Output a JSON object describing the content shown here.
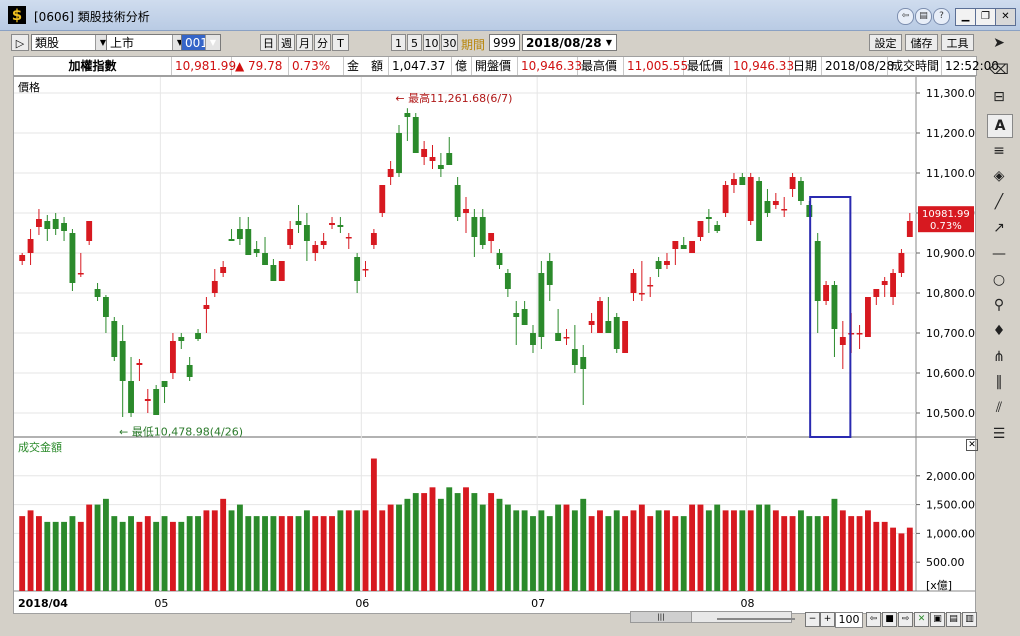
{
  "window": {
    "title": "[0606] 類股技術分析"
  },
  "toolbar": {
    "category": "類股",
    "market": "上市",
    "code": "001",
    "period_buttons": [
      "日",
      "週",
      "月",
      "分",
      "T"
    ],
    "interval_buttons": [
      "1",
      "5",
      "10",
      "30"
    ],
    "period_label": "期間",
    "period_value": "999",
    "date": "2018/08/28",
    "settings": "設定",
    "save": "儲存",
    "tools": "工具"
  },
  "info": {
    "name": "加權指數",
    "price": "10,981.99",
    "change": "▲ 79.78",
    "pct": "0.73%",
    "amount_label": "金　額",
    "amount_value": "1,047.37",
    "amount_unit": "億",
    "open_label": "開盤價",
    "open_value": "10,946.33",
    "high_label": "最高價",
    "high_value": "11,005.55",
    "low_label": "最低價",
    "low_value": "10,946.33",
    "date_label": "日期",
    "date_value": "2018/08/28",
    "time_label": "成交時間",
    "time_value": "12:52:00"
  },
  "chart_data": [
    {
      "type": "candlestick",
      "title": "價格",
      "ylim": [
        10440,
        11340
      ],
      "yticks": [
        10500,
        10600,
        10700,
        10800,
        10900,
        11000,
        11100,
        11200,
        11300
      ],
      "ytick_labels": [
        "10,500.00",
        "10,600.00",
        "10,700.00",
        "10,800.00",
        "10,900.00",
        "11,000.00",
        "11,100.00",
        "11,200.00",
        "11,300.00"
      ],
      "x_labels": [
        "2018/04",
        "05",
        "06",
        "07",
        "08"
      ],
      "x_label_index": [
        0,
        17,
        41,
        62,
        87
      ],
      "annotation_high": "最高11,261.68(6/7)",
      "annotation_low": "最低10,478.98(4/26)",
      "last_price_tag": [
        "10981.99",
        "0.73%"
      ],
      "ohlc": [
        [
          10880,
          10900,
          10870,
          10895
        ],
        [
          10900,
          10960,
          10870,
          10935
        ],
        [
          10965,
          11010,
          10945,
          10985
        ],
        [
          10980,
          10995,
          10930,
          10960
        ],
        [
          10985,
          11000,
          10945,
          10960
        ],
        [
          10975,
          10990,
          10930,
          10955
        ],
        [
          10950,
          10960,
          10805,
          10825
        ],
        [
          10850,
          10900,
          10840,
          10850
        ],
        [
          10930,
          10980,
          10920,
          10980
        ],
        [
          10810,
          10825,
          10780,
          10790
        ],
        [
          10790,
          10795,
          10700,
          10740
        ],
        [
          10730,
          10740,
          10630,
          10640
        ],
        [
          10680,
          10720,
          10490,
          10580
        ],
        [
          10580,
          10640,
          10490,
          10500
        ],
        [
          10620,
          10635,
          10580,
          10625
        ],
        [
          10530,
          10560,
          10500,
          10535
        ],
        [
          10560,
          10570,
          10500,
          10495
        ],
        [
          10580,
          10580,
          10525,
          10565
        ],
        [
          10600,
          10700,
          10585,
          10680
        ],
        [
          10690,
          10700,
          10660,
          10680
        ],
        [
          10620,
          10640,
          10580,
          10590
        ],
        [
          10700,
          10710,
          10680,
          10685
        ],
        [
          10760,
          10790,
          10700,
          10770
        ],
        [
          10800,
          10860,
          10790,
          10830
        ],
        [
          10850,
          10880,
          10840,
          10865
        ],
        [
          10935,
          10960,
          10930,
          10930
        ],
        [
          10960,
          10990,
          10920,
          10935
        ],
        [
          10960,
          10990,
          10900,
          10895
        ],
        [
          10910,
          10930,
          10890,
          10900
        ],
        [
          10900,
          10940,
          10880,
          10870
        ],
        [
          10870,
          10885,
          10840,
          10830
        ],
        [
          10830,
          10880,
          10830,
          10880
        ],
        [
          10920,
          10980,
          10910,
          10960
        ],
        [
          10980,
          11020,
          10950,
          10970
        ],
        [
          10970,
          11000,
          10880,
          10930
        ],
        [
          10900,
          10930,
          10880,
          10920
        ],
        [
          10920,
          10950,
          10910,
          10930
        ],
        [
          10970,
          10990,
          10960,
          10975
        ],
        [
          10970,
          10990,
          10950,
          10965
        ],
        [
          10940,
          10950,
          10910,
          10940
        ],
        [
          10890,
          10900,
          10800,
          10830
        ],
        [
          10860,
          10880,
          10840,
          10860
        ],
        [
          10920,
          10960,
          10910,
          10950
        ],
        [
          11000,
          11070,
          10990,
          11070
        ],
        [
          11090,
          11130,
          11070,
          11110
        ],
        [
          11200,
          11220,
          11090,
          11100
        ],
        [
          11250,
          11262,
          11180,
          11240
        ],
        [
          11240,
          11250,
          11150,
          11150
        ],
        [
          11140,
          11180,
          11120,
          11160
        ],
        [
          11130,
          11170,
          11110,
          11140
        ],
        [
          11120,
          11150,
          11090,
          11110
        ],
        [
          11150,
          11190,
          11120,
          11120
        ],
        [
          11070,
          11090,
          10980,
          10990
        ],
        [
          11000,
          11040,
          10950,
          11010
        ],
        [
          10990,
          11010,
          10890,
          10940
        ],
        [
          10990,
          11010,
          10910,
          10920
        ],
        [
          10930,
          10950,
          10900,
          10950
        ],
        [
          10900,
          10910,
          10860,
          10870
        ],
        [
          10850,
          10860,
          10790,
          10810
        ],
        [
          10750,
          10780,
          10670,
          10740
        ],
        [
          10760,
          10780,
          10730,
          10720
        ],
        [
          10700,
          10720,
          10650,
          10670
        ],
        [
          10850,
          10880,
          10660,
          10690
        ],
        [
          10880,
          10900,
          10780,
          10820
        ],
        [
          10700,
          10760,
          10690,
          10680
        ],
        [
          10690,
          10710,
          10670,
          10690
        ],
        [
          10660,
          10720,
          10600,
          10620
        ],
        [
          10640,
          10670,
          10520,
          10610
        ],
        [
          10720,
          10750,
          10700,
          10730
        ],
        [
          10700,
          10790,
          10700,
          10780
        ],
        [
          10730,
          10790,
          10710,
          10700
        ],
        [
          10740,
          10750,
          10650,
          10660
        ],
        [
          10650,
          10730,
          10650,
          10730
        ],
        [
          10800,
          10860,
          10780,
          10850
        ],
        [
          10800,
          10880,
          10780,
          10800
        ],
        [
          10820,
          10840,
          10790,
          10820
        ],
        [
          10880,
          10890,
          10840,
          10860
        ],
        [
          10870,
          10900,
          10860,
          10880
        ],
        [
          10910,
          10930,
          10870,
          10930
        ],
        [
          10920,
          10940,
          10910,
          10910
        ],
        [
          10900,
          10930,
          10900,
          10930
        ],
        [
          10940,
          10980,
          10930,
          10980
        ],
        [
          10990,
          11010,
          10950,
          10985
        ],
        [
          10970,
          10980,
          10950,
          10955
        ],
        [
          11000,
          11080,
          10990,
          11070
        ],
        [
          11070,
          11100,
          11050,
          11085
        ],
        [
          11090,
          11100,
          11080,
          11070
        ],
        [
          10980,
          11100,
          10970,
          11090
        ],
        [
          11080,
          11090,
          10930,
          10930
        ],
        [
          11030,
          11060,
          10990,
          11000
        ],
        [
          11020,
          11050,
          11010,
          11030
        ],
        [
          11010,
          11040,
          10990,
          11010
        ],
        [
          11060,
          11100,
          11040,
          11090
        ],
        [
          11080,
          11090,
          11020,
          11030
        ],
        [
          11020,
          11030,
          10990,
          10990
        ],
        [
          10930,
          10950,
          10700,
          10780
        ],
        [
          10780,
          10830,
          10770,
          10820
        ],
        [
          10820,
          10830,
          10640,
          10710
        ],
        [
          10670,
          10730,
          10610,
          10690
        ],
        [
          10700,
          10750,
          10650,
          10700
        ],
        [
          10700,
          10720,
          10660,
          10700
        ],
        [
          10690,
          10750,
          10690,
          10790
        ],
        [
          10790,
          10810,
          10770,
          10810
        ],
        [
          10820,
          10840,
          10790,
          10830
        ],
        [
          10790,
          10860,
          10770,
          10850
        ],
        [
          10850,
          10910,
          10840,
          10900
        ],
        [
          10940,
          11000,
          10940,
          10980
        ]
      ]
    },
    {
      "type": "bar",
      "title": "成交金額",
      "ylim": [
        0,
        2500
      ],
      "yticks": [
        500,
        1000,
        1500,
        2000
      ],
      "ytick_labels": [
        "500.00",
        "1,000.00",
        "1,500.00",
        "2,000.00"
      ],
      "unit_label": "[x億]",
      "values": [
        1300,
        1400,
        1300,
        1200,
        1200,
        1200,
        1300,
        1200,
        1500,
        1500,
        1600,
        1300,
        1200,
        1300,
        1200,
        1300,
        1200,
        1300,
        1200,
        1200,
        1300,
        1300,
        1400,
        1400,
        1600,
        1400,
        1500,
        1300,
        1300,
        1300,
        1300,
        1300,
        1300,
        1300,
        1400,
        1300,
        1300,
        1300,
        1400,
        1400,
        1400,
        1400,
        2300,
        1400,
        1500,
        1500,
        1600,
        1700,
        1700,
        1800,
        1600,
        1800,
        1700,
        1800,
        1700,
        1500,
        1700,
        1600,
        1500,
        1400,
        1400,
        1300,
        1400,
        1300,
        1500,
        1500,
        1400,
        1600,
        1300,
        1400,
        1300,
        1400,
        1300,
        1400,
        1500,
        1300,
        1400,
        1400,
        1300,
        1300,
        1500,
        1500,
        1400,
        1500,
        1400,
        1400,
        1400,
        1400,
        1500,
        1500,
        1400,
        1300,
        1300,
        1400,
        1300,
        1300,
        1300,
        1600,
        1400,
        1300,
        1300,
        1400,
        1200,
        1200,
        1100,
        1000,
        1100,
        1000,
        1000,
        1100
      ]
    }
  ]
}
